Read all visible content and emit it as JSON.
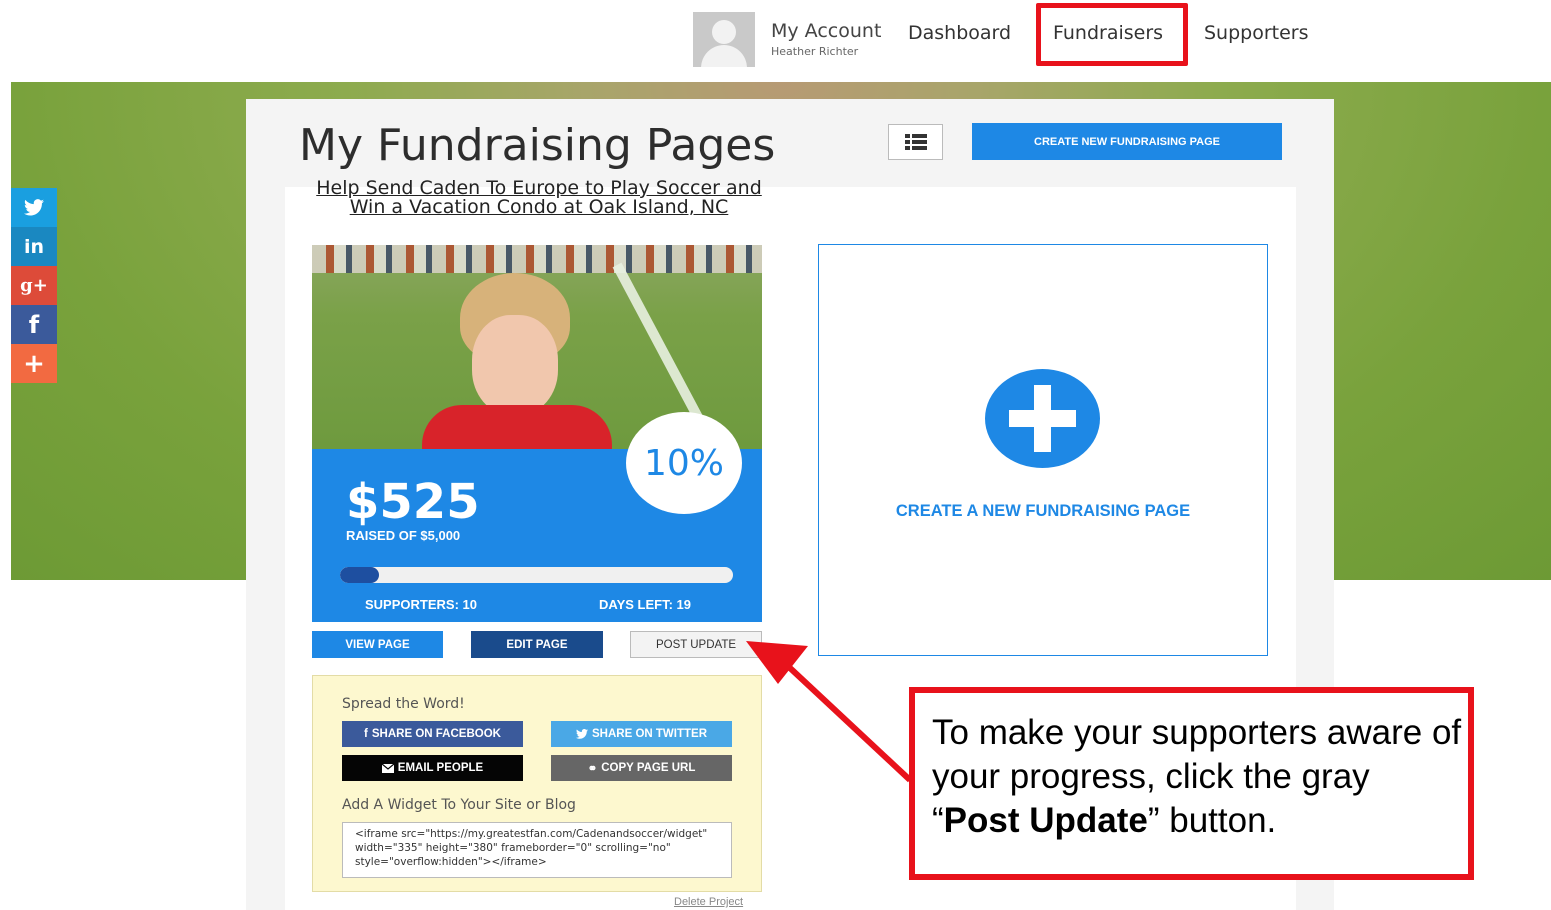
{
  "topnav": {
    "account_title": "My Account",
    "account_user": "Heather Richter",
    "links": [
      "Dashboard",
      "Fundraisers",
      "Supporters"
    ]
  },
  "social": {
    "twitter": "twitter-icon",
    "linkedin": "in",
    "googleplus": "g+",
    "facebook": "f",
    "add": "+"
  },
  "main": {
    "title": "My Fundraising Pages",
    "create_button": "CREATE NEW FUNDRAISING PAGE"
  },
  "project": {
    "title": "Help Send Caden To Europe to Play Soccer and Win a Vacation Condo at Oak Island, NC",
    "percent_label": "10%",
    "amount": "$525",
    "raised_of": "RAISED OF $5,000",
    "progress_fraction": 0.1,
    "supporters": "SUPPORTERS: 10",
    "days_left": "DAYS LEFT: 19",
    "buttons": {
      "view": "VIEW PAGE",
      "edit": "EDIT PAGE",
      "post": "POST UPDATE"
    },
    "spread": {
      "title": "Spread the Word!",
      "facebook": "SHARE ON FACEBOOK",
      "twitter": "SHARE ON TWITTER",
      "email": "EMAIL PEOPLE",
      "copy_url": "COPY PAGE URL",
      "widget_label": "Add A Widget To Your Site or Blog",
      "widget_code": "<iframe src=\"https://my.greatestfan.com/Cadenandsoccer/widget\" width=\"335\" height=\"380\" frameborder=\"0\" scrolling=\"no\" style=\"overflow:hidden\"></iframe>"
    },
    "delete": "Delete Project"
  },
  "create_card": {
    "label": "CREATE A NEW FUNDRAISING PAGE"
  },
  "annotation": {
    "text_before": "To make your supporters aware of your progress, click the gray “",
    "text_bold": "Post Update",
    "text_after": "” button."
  },
  "colors": {
    "accent": "#1e88e5",
    "dark_blue": "#1a4b8c",
    "highlight_red": "#e8121b"
  }
}
